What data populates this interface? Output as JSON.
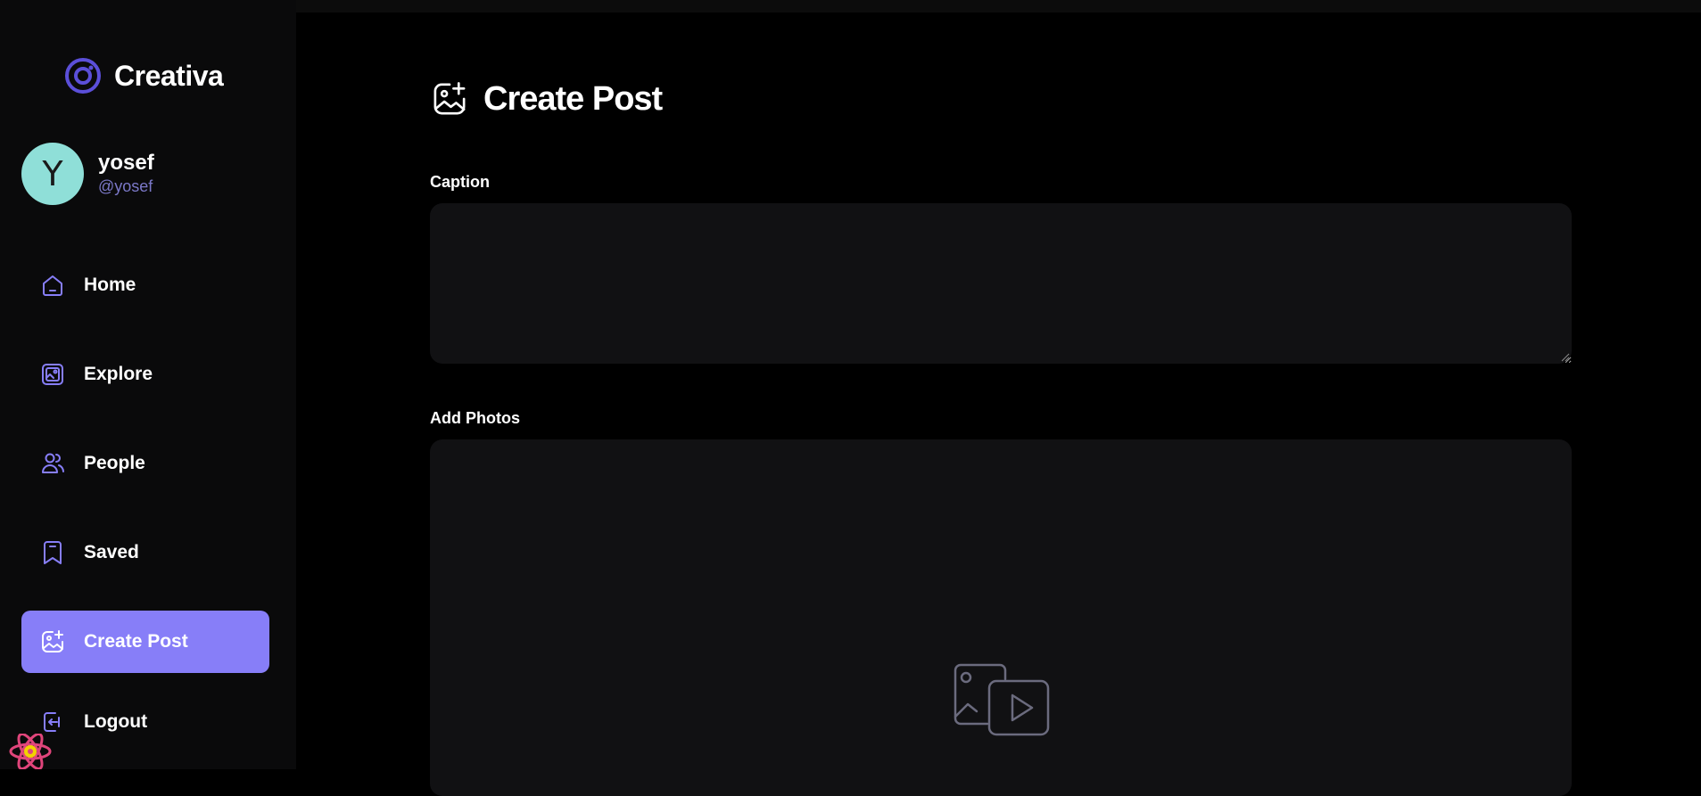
{
  "app": {
    "name": "Creativa",
    "accent_color": "#877ef8",
    "logo_color": "#5b4fd9"
  },
  "profile": {
    "avatar_initial": "Y",
    "avatar_color": "#8fdfd8",
    "name": "yosef",
    "handle": "@yosef"
  },
  "sidebar": {
    "items": [
      {
        "label": "Home",
        "icon": "home-icon",
        "active": false
      },
      {
        "label": "Explore",
        "icon": "wallpaper-icon",
        "active": false
      },
      {
        "label": "People",
        "icon": "people-icon",
        "active": false
      },
      {
        "label": "Saved",
        "icon": "bookmark-icon",
        "active": false
      },
      {
        "label": "Create Post",
        "icon": "gallery-add-icon",
        "active": true
      }
    ],
    "logout_label": "Logout"
  },
  "main": {
    "title": "Create Post",
    "caption_label": "Caption",
    "caption_value": "",
    "photos_label": "Add Photos"
  }
}
